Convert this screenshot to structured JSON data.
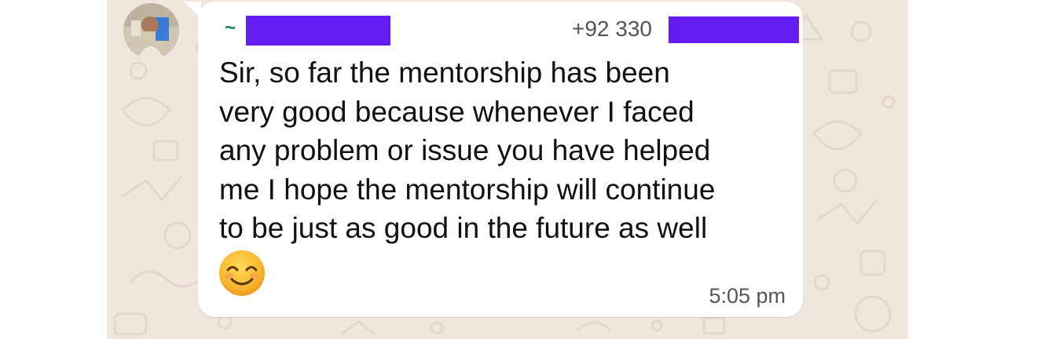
{
  "message": {
    "sender_prefix": "~",
    "phone_prefix": "+92 330",
    "lines": [
      "Sir, so far the mentorship has been",
      "very good because whenever I faced",
      "any problem or issue you have helped",
      "me I hope the mentorship will continue",
      "to be just as good in the future as well"
    ],
    "emoji": "smiling-face-with-smiling-eyes",
    "time": "5:05 pm"
  },
  "colors": {
    "chat_background": "#efe7dd",
    "bubble": "#ffffff",
    "sender_accent": "#14806b",
    "redaction": "#651cf2",
    "meta_text": "#555555"
  }
}
